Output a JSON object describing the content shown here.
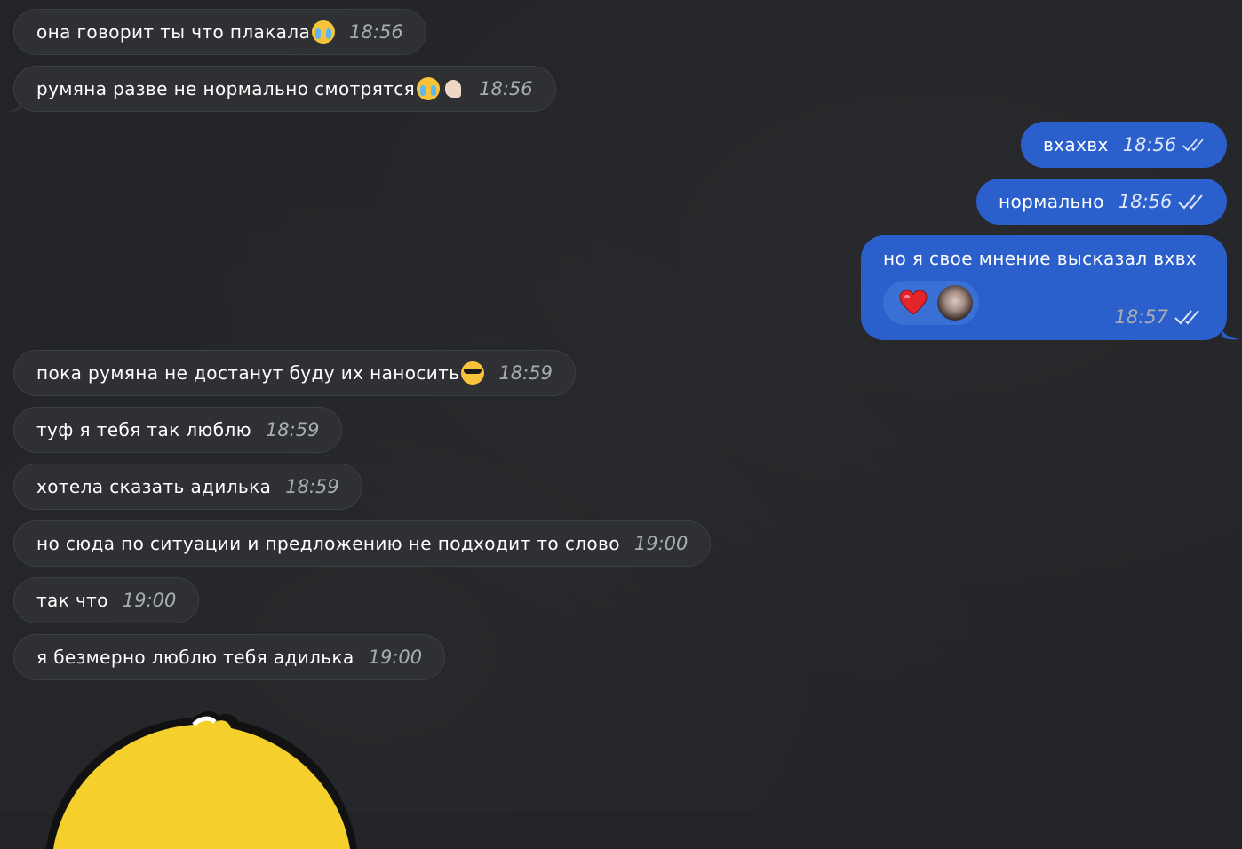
{
  "incoming": [
    {
      "text": "она говорит ты что плакала",
      "emoji": [
        "loudly-crying-face"
      ],
      "time": "18:56"
    },
    {
      "text": "румяна разве не нормально смотрятся",
      "emoji": [
        "loudly-crying-face",
        "ok-hand"
      ],
      "time": "18:56"
    },
    {
      "text": "пока румяна не достанут буду их наносить",
      "emoji": [
        "smiling-face-with-sunglasses"
      ],
      "time": "18:59"
    },
    {
      "text": "туф я тебя так люблю",
      "time": "18:59"
    },
    {
      "text": "хотела сказать адилька",
      "time": "18:59"
    },
    {
      "text": "но сюда по ситуации и предложению не подходит то слово",
      "time": "19:00"
    },
    {
      "text": "так что",
      "time": "19:00"
    },
    {
      "text": "я безмерно люблю тебя адилька",
      "time": "19:00"
    }
  ],
  "outgoing": [
    {
      "text": "вхахвх",
      "time": "18:56",
      "status": "read"
    },
    {
      "text": "нормально",
      "time": "18:56",
      "status": "read"
    },
    {
      "text": "но я свое мнение высказал вхвх",
      "time": "18:57",
      "status": "read",
      "reaction": "red-heart"
    }
  ],
  "colors": {
    "background": "#222427",
    "incoming_bubble": "#2e3033",
    "outgoing_bubble": "#2b5fcc",
    "sticker": "#f5cf2b"
  }
}
